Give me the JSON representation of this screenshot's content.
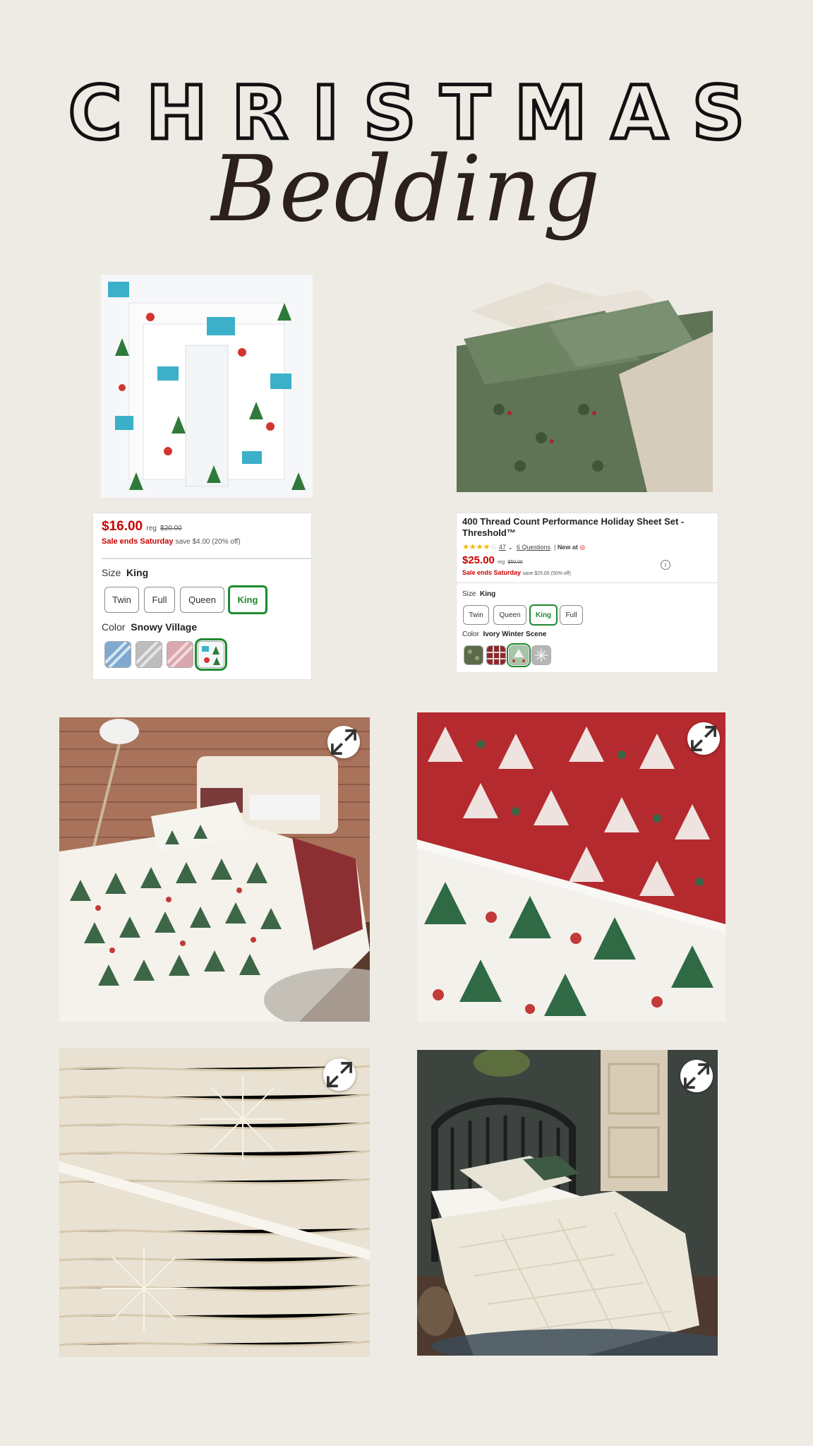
{
  "header": {
    "title_line1": "CHRISTMAS",
    "title_line2": "Bedding"
  },
  "product1": {
    "price": "$16.00",
    "reg_label": "reg",
    "reg_price": "$20.00",
    "sale_text": "Sale ends Saturday",
    "save_text": "save $4.00 (20% off)",
    "size_label": "Size",
    "size_value": "King",
    "sizes": [
      "Twin",
      "Full",
      "Queen",
      "King"
    ],
    "selected_size": "King",
    "color_label": "Color",
    "color_value": "Snowy Village",
    "swatch_colors": [
      "#7fa9cf",
      "#bdbdbd",
      "#d9a7ad",
      "#cfe3d6"
    ]
  },
  "product2": {
    "title": "400 Thread Count Performance Holiday Sheet Set - Threshold™",
    "rating": 4,
    "review_count": "47",
    "questions_text": "6 Questions",
    "new_at_text": "New at",
    "price": "$25.00",
    "reg_label": "reg",
    "reg_price": "$50.00",
    "sale_text": "Sale ends Saturday",
    "save_text": "save $25.00 (50% off)",
    "size_label": "Size",
    "size_value": "King",
    "sizes": [
      "Twin",
      "Queen",
      "King",
      "Full"
    ],
    "selected_size": "King",
    "color_label": "Color",
    "color_value": "Ivory Winter Scene",
    "swatch_colors": [
      "#5b6b4a",
      "#8b2a2e",
      "#a8c4a8",
      "#b5b5b5"
    ]
  },
  "colors": {
    "background": "#eeebe5",
    "sale_red": "#cc0000",
    "selected_green": "#1d8a2d"
  }
}
